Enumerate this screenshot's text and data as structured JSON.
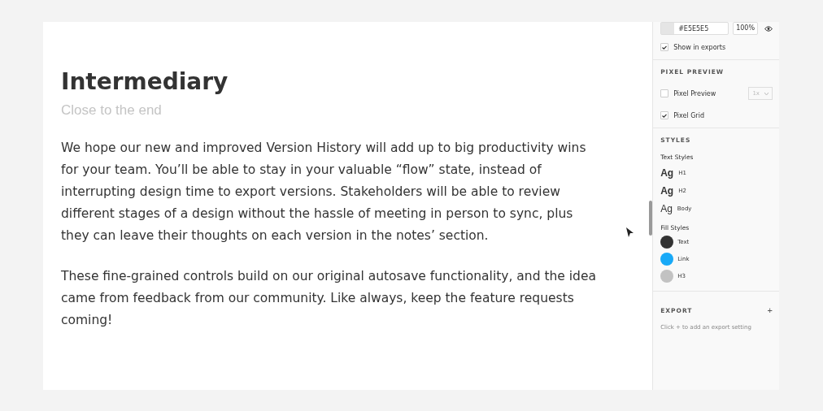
{
  "article": {
    "title": "Intermediary",
    "subtitle": "Close to the end",
    "paragraphs": [
      "We hope our new and improved Version History will add up to big productivity wins for your team. You’ll be able to stay in your valuable “flow” state, instead of interrupting design time to export versions. Stakeholders will be able to review different stages of a design without the hassle of meeting in person to sync, plus they can leave their thoughts on each version in the notes’ section.",
      "These fine-grained controls build on our original autosave functionality, and the idea came from feedback from our community. Like always, keep the feature requests coming!"
    ]
  },
  "panel": {
    "fill": {
      "color": "#e5e5e5",
      "hex": "#E5E5E5",
      "opacity": "100%",
      "show_in_exports": {
        "label": "Show in exports",
        "checked": true
      }
    },
    "pixel_preview": {
      "heading": "PIXEL PREVIEW",
      "options": [
        {
          "label": "Pixel Preview",
          "checked": false
        },
        {
          "label": "Pixel Grid",
          "checked": true
        }
      ],
      "scale": "1x"
    },
    "styles": {
      "heading": "STYLES",
      "text_styles_label": "Text Styles",
      "text_styles": [
        {
          "sample": "Ag",
          "name": "H1",
          "kind": "bold"
        },
        {
          "sample": "Ag",
          "name": "H2",
          "kind": "semibold"
        },
        {
          "sample": "Ag",
          "name": "Body",
          "kind": "regular"
        }
      ],
      "fill_styles_label": "Fill Styles",
      "fill_styles": [
        {
          "name": "Text",
          "color": "#333333"
        },
        {
          "name": "Link",
          "color": "#18a9f7"
        },
        {
          "name": "H3",
          "color": "#c2c2c2"
        }
      ]
    },
    "export": {
      "heading": "EXPORT",
      "add": "+",
      "hint": "Click + to add an export setting"
    }
  }
}
